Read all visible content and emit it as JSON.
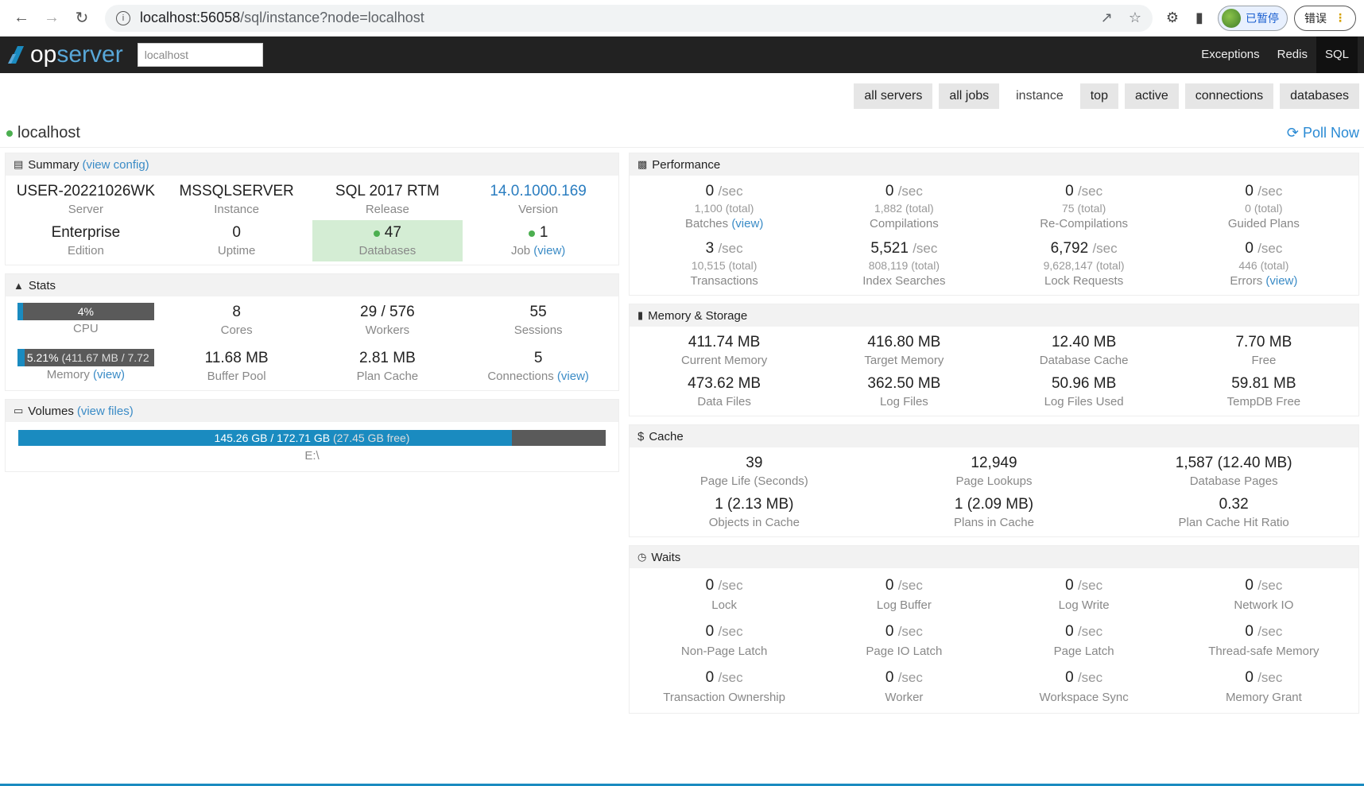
{
  "browser": {
    "url_host": "localhost:56058",
    "url_path": "/sql/instance?node=localhost",
    "profile_label": "已暂停",
    "error_label": "错误"
  },
  "app": {
    "logo_prefix": "op",
    "logo_suffix": "server",
    "search_value": "localhost",
    "nav": [
      "Exceptions",
      "Redis",
      "SQL"
    ],
    "active_nav": "SQL"
  },
  "tabs": [
    "all servers",
    "all jobs",
    "instance",
    "top",
    "active",
    "connections",
    "databases"
  ],
  "active_tab": "instance",
  "page": {
    "title": "localhost",
    "poll_label": "Poll Now"
  },
  "summary": {
    "title": "Summary",
    "link": "(view config)",
    "server": {
      "value": "USER-20221026WK",
      "label": "Server"
    },
    "instance": {
      "value": "MSSQLSERVER",
      "label": "Instance"
    },
    "release": {
      "value": "SQL 2017 RTM",
      "label": "Release"
    },
    "version": {
      "value": "14.0.1000.169",
      "label": "Version"
    },
    "edition": {
      "value": "Enterprise",
      "label": "Edition"
    },
    "uptime": {
      "value": "0",
      "label": "Uptime"
    },
    "databases": {
      "value": "47",
      "label": "Databases"
    },
    "job": {
      "value": "1",
      "label": "Job",
      "link": "(view)"
    }
  },
  "stats": {
    "title": "Stats",
    "cpu": {
      "percent": 4,
      "text": "4%",
      "label": "CPU"
    },
    "cores": {
      "value": "8",
      "label": "Cores"
    },
    "workers": {
      "value": "29 / 576",
      "label": "Workers"
    },
    "sessions": {
      "value": "55",
      "label": "Sessions"
    },
    "memory": {
      "percent": 5.21,
      "text": "5.21%",
      "detail": "(411.67 MB / 7.72",
      "label": "Memory",
      "link": "(view)"
    },
    "buffer_pool": {
      "value": "11.68 MB",
      "label": "Buffer Pool"
    },
    "plan_cache": {
      "value": "2.81 MB",
      "label": "Plan Cache"
    },
    "connections": {
      "value": "5",
      "label": "Connections",
      "link": "(view)"
    }
  },
  "volumes": {
    "title": "Volumes",
    "link": "(view files)",
    "bar_percent": 84.1,
    "bar_text": "145.26 GB / 172.71 GB",
    "bar_free": "(27.45 GB free)",
    "drive": "E:\\"
  },
  "performance": {
    "title": "Performance",
    "sec_unit": "/sec",
    "total_unit": "(total)",
    "items": [
      {
        "rate": "0",
        "total": "1,100",
        "label": "Batches",
        "link": "(view)"
      },
      {
        "rate": "0",
        "total": "1,882",
        "label": "Compilations",
        "link": ""
      },
      {
        "rate": "0",
        "total": "75",
        "label": "Re-Compilations",
        "link": ""
      },
      {
        "rate": "0",
        "total": "0",
        "label": "Guided Plans",
        "link": ""
      },
      {
        "rate": "3",
        "total": "10,515",
        "label": "Transactions",
        "link": ""
      },
      {
        "rate": "5,521",
        "total": "808,119",
        "label": "Index Searches",
        "link": ""
      },
      {
        "rate": "6,792",
        "total": "9,628,147",
        "label": "Lock Requests",
        "link": ""
      },
      {
        "rate": "0",
        "total": "446",
        "label": "Errors",
        "link": "(view)"
      }
    ]
  },
  "memory_storage": {
    "title": "Memory & Storage",
    "items": [
      {
        "value": "411.74 MB",
        "label": "Current Memory"
      },
      {
        "value": "416.80 MB",
        "label": "Target Memory"
      },
      {
        "value": "12.40 MB",
        "label": "Database Cache"
      },
      {
        "value": "7.70 MB",
        "label": "Free"
      },
      {
        "value": "473.62 MB",
        "label": "Data Files"
      },
      {
        "value": "362.50 MB",
        "label": "Log Files"
      },
      {
        "value": "50.96 MB",
        "label": "Log Files Used"
      },
      {
        "value": "59.81 MB",
        "label": "TempDB Free"
      }
    ]
  },
  "cache": {
    "title": "Cache",
    "items": [
      {
        "value": "39",
        "label": "Page Life (Seconds)"
      },
      {
        "value": "12,949",
        "label": "Page Lookups"
      },
      {
        "value": "1,587 (12.40 MB)",
        "label": "Database Pages"
      },
      {
        "value": "1 (2.13 MB)",
        "label": "Objects in Cache"
      },
      {
        "value": "1 (2.09 MB)",
        "label": "Plans in Cache"
      },
      {
        "value": "0.32",
        "label": "Plan Cache Hit Ratio"
      }
    ]
  },
  "waits": {
    "title": "Waits",
    "sec_unit": "/sec",
    "items": [
      {
        "value": "0",
        "label": "Lock"
      },
      {
        "value": "0",
        "label": "Log Buffer"
      },
      {
        "value": "0",
        "label": "Log Write"
      },
      {
        "value": "0",
        "label": "Network IO"
      },
      {
        "value": "0",
        "label": "Non-Page Latch"
      },
      {
        "value": "0",
        "label": "Page IO Latch"
      },
      {
        "value": "0",
        "label": "Page Latch"
      },
      {
        "value": "0",
        "label": "Thread-safe Memory"
      },
      {
        "value": "0",
        "label": "Transaction Ownership"
      },
      {
        "value": "0",
        "label": "Worker"
      },
      {
        "value": "0",
        "label": "Workspace Sync"
      },
      {
        "value": "0",
        "label": "Memory Grant"
      }
    ]
  },
  "colors": {
    "accent": "#1a8bc0",
    "header_bg": "#222222",
    "good": "#d4edd4",
    "link": "#3a8bc6"
  }
}
